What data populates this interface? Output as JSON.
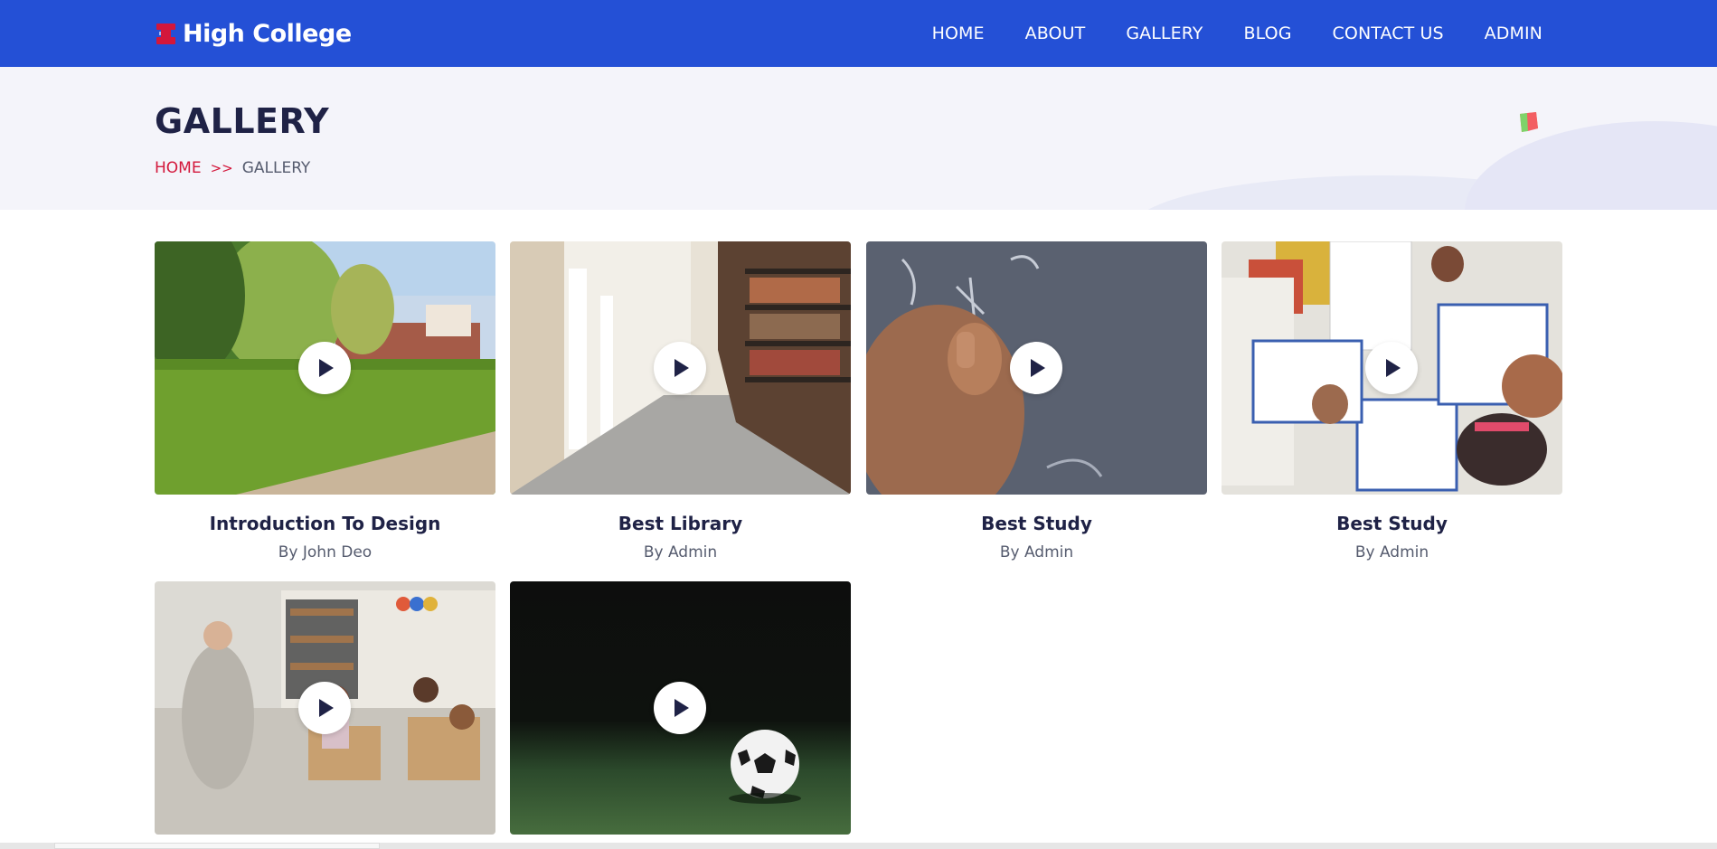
{
  "brand": {
    "name": "High College",
    "accent": "#d3173b",
    "nav_bg": "#2450d6"
  },
  "nav": {
    "items": [
      {
        "label": "HOME"
      },
      {
        "label": "ABOUT"
      },
      {
        "label": "GALLERY"
      },
      {
        "label": "BLOG"
      },
      {
        "label": "CONTACT US"
      },
      {
        "label": "ADMIN"
      }
    ]
  },
  "page": {
    "title": "GALLERY",
    "breadcrumb": {
      "home": "HOME",
      "separator": ">>",
      "current": "GALLERY"
    }
  },
  "gallery": [
    {
      "title": "Introduction To Design",
      "author": "By John Deo",
      "image": "campus-lawn",
      "icon": "play-icon"
    },
    {
      "title": "Best Library",
      "author": "By Admin",
      "image": "library-shelves",
      "icon": "play-icon"
    },
    {
      "title": "Best Study",
      "author": "By Admin",
      "image": "chalkboard-hand",
      "icon": "play-icon"
    },
    {
      "title": "Best Study",
      "author": "By Admin",
      "image": "kids-worksheets",
      "icon": "play-icon"
    },
    {
      "title": "",
      "author": "",
      "image": "classroom",
      "icon": "play-icon"
    },
    {
      "title": "",
      "author": "",
      "image": "soccer-ball",
      "icon": "play-icon"
    }
  ]
}
